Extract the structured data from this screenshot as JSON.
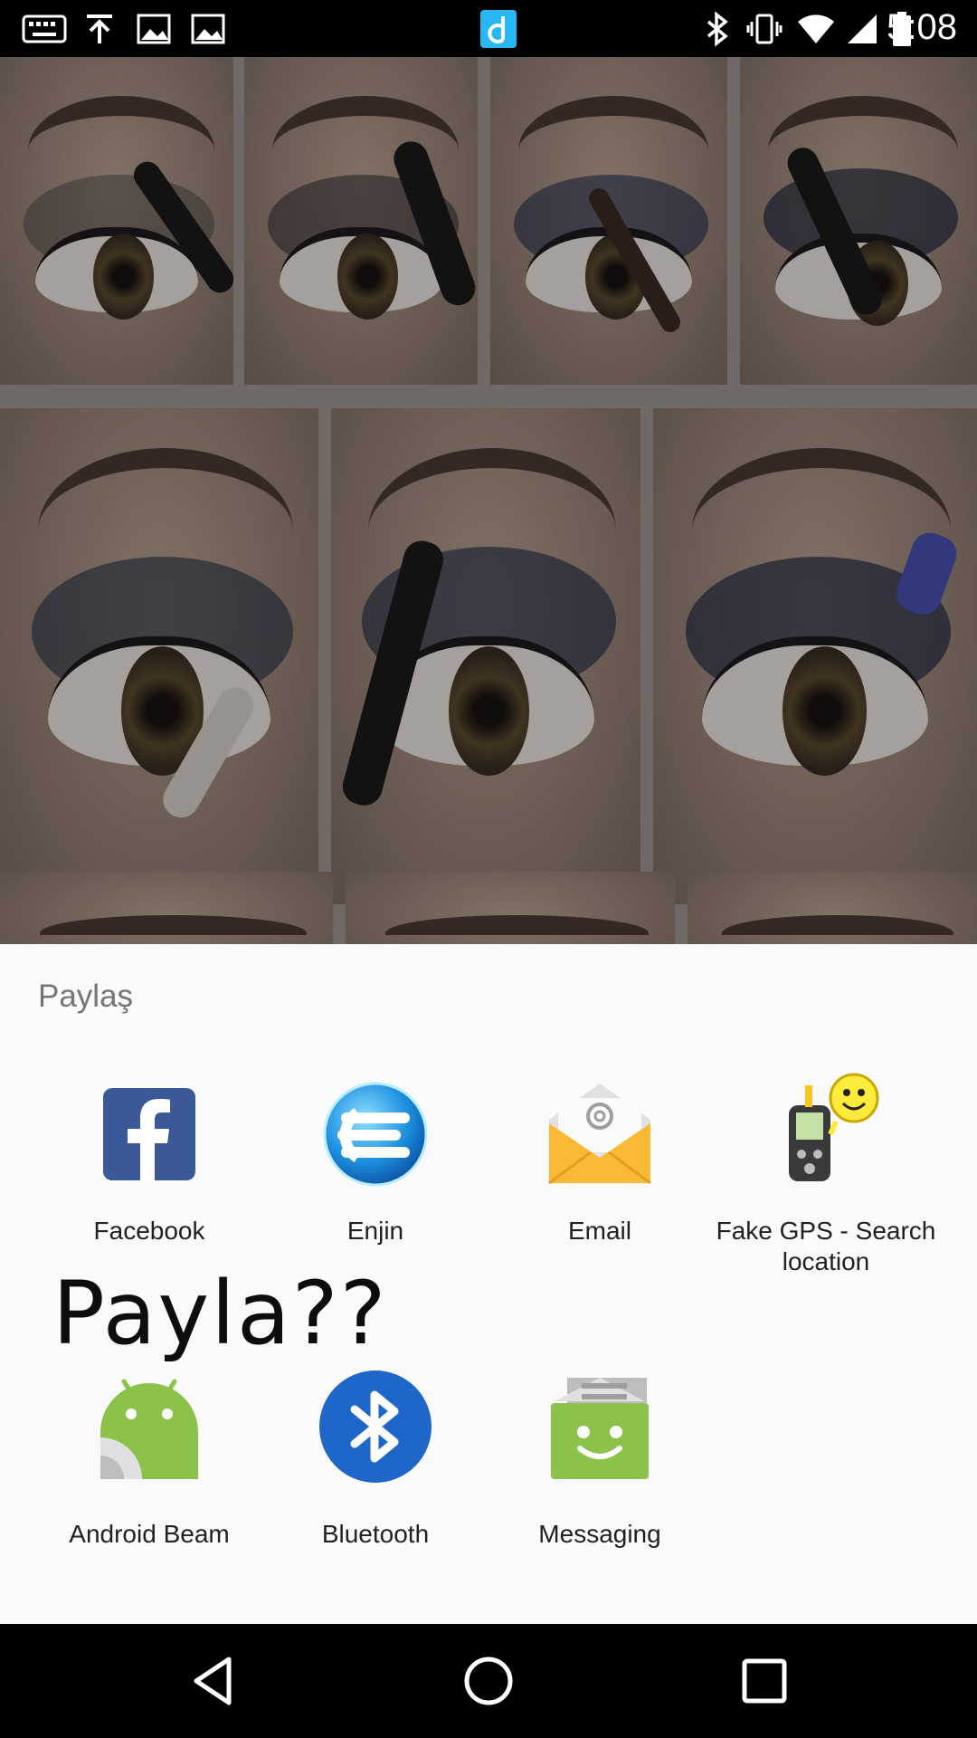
{
  "status_bar": {
    "time": "5:08",
    "left_icons": [
      "keyboard-icon",
      "upload-icon",
      "image-icon",
      "image-icon",
      "app-d-icon"
    ],
    "right_icons": [
      "bluetooth-icon",
      "vibrate-icon",
      "wifi-icon",
      "signal-icon",
      "battery-icon"
    ]
  },
  "share_sheet": {
    "title": "Paylaş",
    "watermark_text": "Payla??",
    "apps_row1": [
      {
        "label": "Facebook",
        "icon": "facebook-icon"
      },
      {
        "label": "Enjin",
        "icon": "enjin-icon"
      },
      {
        "label": "Email",
        "icon": "email-icon"
      },
      {
        "label_line1": "Fake GPS - Search",
        "label_line2": "location",
        "icon": "fake-gps-icon"
      }
    ],
    "apps_row2": [
      {
        "label": "Android Beam",
        "icon": "android-beam-icon"
      },
      {
        "label": "Bluetooth",
        "icon": "bluetooth-icon"
      },
      {
        "label": "Messaging",
        "icon": "messaging-icon"
      }
    ]
  },
  "colors": {
    "facebook": "#3b5998",
    "bluetooth": "#1e66c8",
    "messaging": "#8bc34a",
    "email": "#f9b935",
    "sheet_bg": "#fafafa"
  },
  "nav_bar": {
    "buttons": [
      "back-icon",
      "home-icon",
      "recents-icon"
    ]
  }
}
